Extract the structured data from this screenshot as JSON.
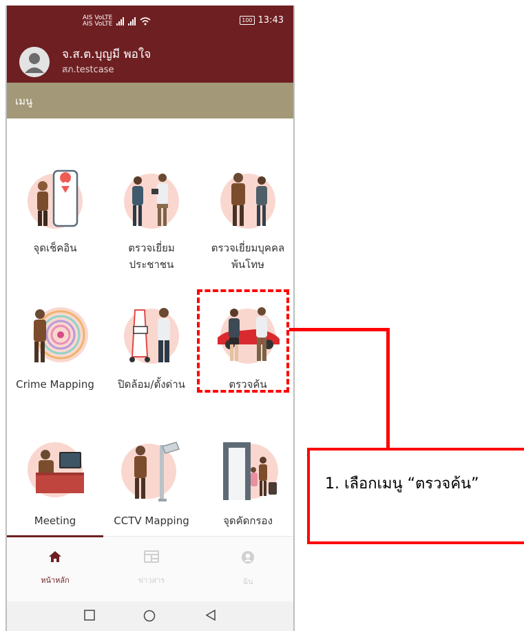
{
  "status_bar": {
    "carrier_top": "AIS VoLTE",
    "carrier_bottom": "AIS VoLTE",
    "battery": "100",
    "time": "13:43"
  },
  "user": {
    "name": "จ.ส.ต.บุญมี พอใจ",
    "sub": "สภ.testcase"
  },
  "menu_title": "เมนู",
  "menu_items": [
    {
      "label_line1": "จุดเช็คอิน",
      "label_line2": ""
    },
    {
      "label_line1": "ตรวจเยี่ยม",
      "label_line2": "ประชาชน"
    },
    {
      "label_line1": "ตรวจเยี่ยมบุคคล",
      "label_line2": "พ้นโทษ"
    },
    {
      "label_line1": "Crime Mapping",
      "label_line2": ""
    },
    {
      "label_line1": "ปิดล้อม/ตั้งด่าน",
      "label_line2": ""
    },
    {
      "label_line1": "ตรวจค้น",
      "label_line2": ""
    },
    {
      "label_line1": "Meeting",
      "label_line2": ""
    },
    {
      "label_line1": "CCTV Mapping",
      "label_line2": ""
    },
    {
      "label_line1": "จุดคัดกรอง",
      "label_line2": ""
    }
  ],
  "bottom_nav": [
    {
      "label": "หน้าหลัก",
      "icon": "home-icon",
      "active": true
    },
    {
      "label": "ข่าวสาร",
      "icon": "news-icon",
      "active": false
    },
    {
      "label": "ฉัน",
      "icon": "user-icon",
      "active": false
    }
  ],
  "annotation": {
    "text": "1. เลือกเมนู “ตรวจค้น”"
  },
  "colors": {
    "header": "#6e1f22",
    "menu_bar": "#a39877",
    "highlight": "#ff0000",
    "illustration_bg": "#f9d7cf"
  }
}
